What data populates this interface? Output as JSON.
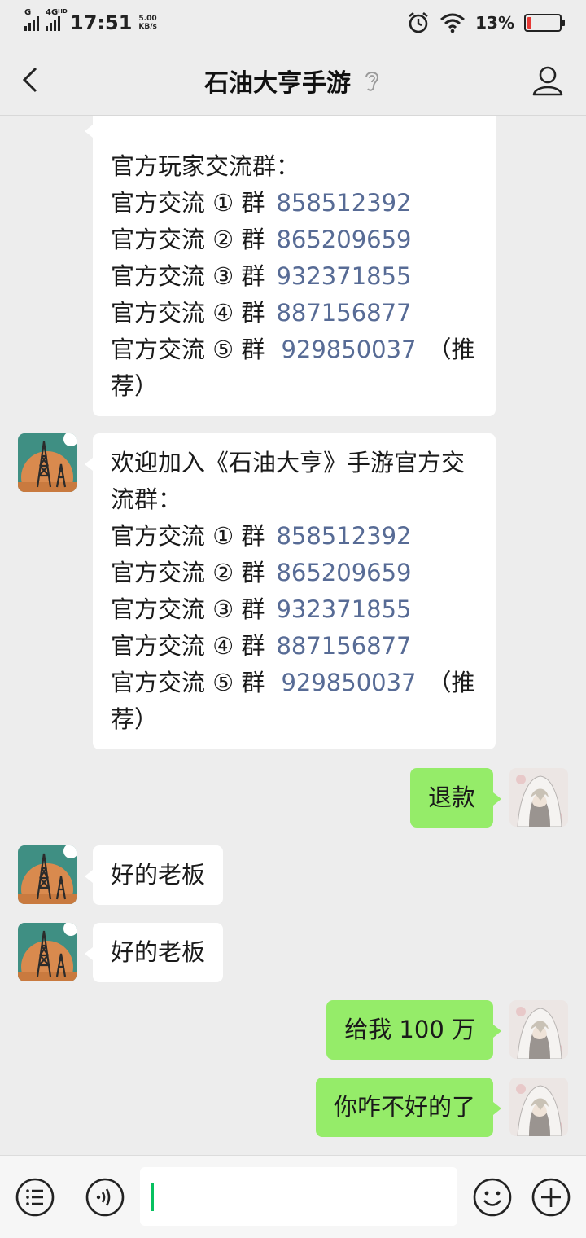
{
  "status_bar": {
    "network_g": "G",
    "network_4g": "4G",
    "hd": "HD",
    "time": "17:51",
    "speed_value": "5.00",
    "speed_unit": "KB/s",
    "battery": "13%",
    "battery_level": 0.13,
    "icons": [
      "signal-icon",
      "alarm-icon",
      "wifi-icon",
      "battery-icon"
    ]
  },
  "header": {
    "title": "石油大亨手游",
    "icons": [
      "back-arrow-icon",
      "ear-icon",
      "profile-icon"
    ]
  },
  "messages": [
    {
      "from": "official",
      "lines": [
        "",
        "官方玩家交流群："
      ],
      "groups": [
        {
          "label": "官方交流 ① 群",
          "number": "858512392"
        },
        {
          "label": "官方交流 ② 群",
          "number": "865209659"
        },
        {
          "label": "官方交流 ③ 群",
          "number": "932371855"
        },
        {
          "label": "官方交流 ④ 群",
          "number": "887156877"
        },
        {
          "label": "官方交流 ⑤ 群",
          "number": "929850037",
          "suffix": "（推"
        }
      ],
      "tail": "荐）"
    },
    {
      "from": "official",
      "intro_1": "欢迎加入《石油大亨》手游官方交",
      "intro_2": "流群：",
      "groups": [
        {
          "label": "官方交流 ① 群",
          "number": "858512392"
        },
        {
          "label": "官方交流 ② 群",
          "number": "865209659"
        },
        {
          "label": "官方交流 ③ 群",
          "number": "932371855"
        },
        {
          "label": "官方交流 ④ 群",
          "number": "887156877"
        },
        {
          "label": "官方交流 ⑤ 群",
          "number": "929850037",
          "suffix": "（推"
        }
      ],
      "tail": "荐）"
    },
    {
      "from": "me",
      "text": "退款"
    },
    {
      "from": "official",
      "text": "好的老板"
    },
    {
      "from": "official",
      "text": "好的老板"
    },
    {
      "from": "me",
      "text": "给我 100 万"
    },
    {
      "from": "me",
      "text": "你咋不好的了"
    }
  ],
  "input_bar": {
    "value": "",
    "icons": [
      "menu-list-icon",
      "voice-icon",
      "emoji-icon",
      "plus-icon"
    ]
  },
  "colors": {
    "background": "#ededed",
    "incoming_bubble": "#ffffff",
    "outgoing_bubble": "#95ec69",
    "link_number": "#576b95",
    "cursor": "#07c160",
    "battery_low": "#e53935"
  }
}
